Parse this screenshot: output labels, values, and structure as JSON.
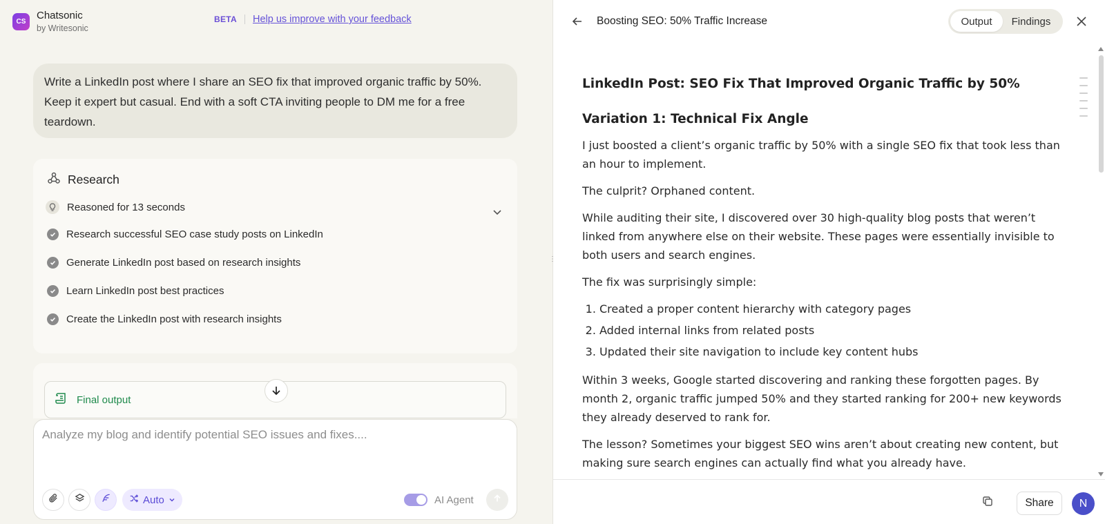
{
  "brand": {
    "logo_text": "CS",
    "name": "Chatsonic",
    "sub": "by Writesonic"
  },
  "header": {
    "beta": "BETA",
    "feedback_link": "Help us improve with your feedback"
  },
  "prompt": {
    "text": "Write a LinkedIn post where I share an SEO fix that improved organic traffic by 50%. Keep it expert but casual. End with a soft CTA inviting people to DM me for a free teardown."
  },
  "research": {
    "title": "Research",
    "reasoned": "Reasoned for 13 seconds",
    "steps": [
      "Research successful SEO case study posts on LinkedIn",
      "Generate LinkedIn post based on research insights",
      "Learn LinkedIn post best practices",
      "Create the LinkedIn post with research insights"
    ]
  },
  "final_output": {
    "label": "Final output"
  },
  "composer": {
    "placeholder": "Analyze my blog and identify potential SEO issues and fixes....",
    "auto_label": "Auto",
    "agent_label": "AI Agent",
    "agent_enabled": true
  },
  "right": {
    "title": "Boosting SEO: 50% Traffic Increase",
    "tabs": [
      "Output",
      "Findings"
    ],
    "active_tab": "Output",
    "share_label": "Share",
    "avatar_initial": "N"
  },
  "document": {
    "h1": "LinkedIn Post: SEO Fix That Improved Organic Traffic by 50%",
    "h2": "Variation 1: Technical Fix Angle",
    "p1": "I just boosted a client’s organic traffic by 50% with a single SEO fix that took less than an hour to implement.",
    "p2": "The culprit? Orphaned content.",
    "p3": "While auditing their site, I discovered over 30 high-quality blog posts that weren’t linked from anywhere else on their website. These pages were essentially invisible to both users and search engines.",
    "p4": "The fix was surprisingly simple:",
    "list": [
      "Created a proper content hierarchy with category pages",
      "Added internal links from related posts",
      "Updated their site navigation to include key content hubs"
    ],
    "p5": "Within 3 weeks, Google started discovering and ranking these forgotten pages. By month 2, organic traffic jumped 50% and they started ranking for 200+ new keywords they already deserved to rank for.",
    "p6": "The lesson? Sometimes your biggest SEO wins aren’t about creating new content, but making sure search engines can actually find what you already have."
  },
  "colors": {
    "accent": "#6552d8",
    "success": "#1f8a4c",
    "avatar": "#4a4fc9"
  }
}
